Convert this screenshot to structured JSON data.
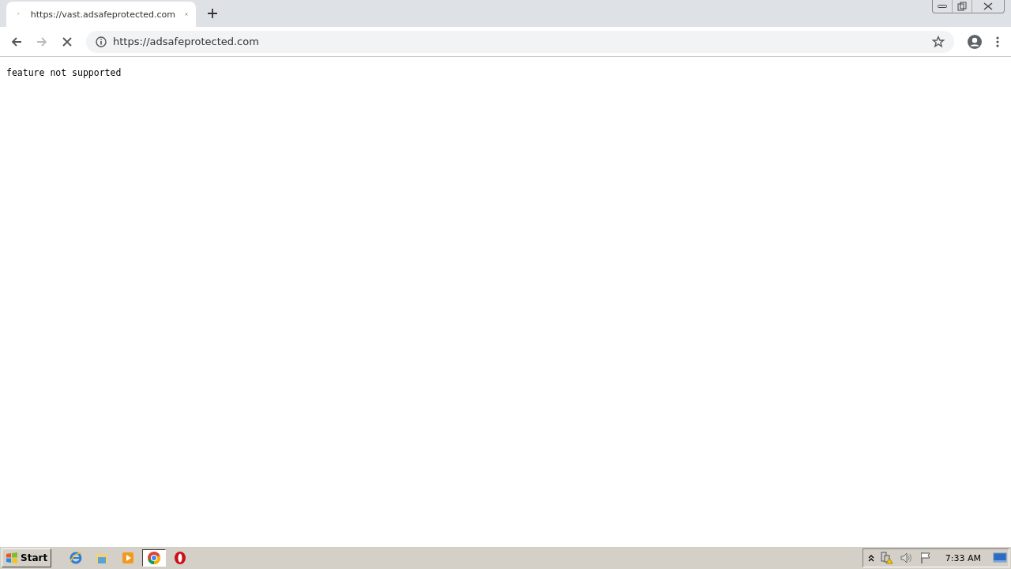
{
  "browser": {
    "tabs": [
      {
        "title": "https://vast.adsafeprotected.com",
        "selected": true,
        "loading": true
      }
    ],
    "address": "https://adsafeprotected.com",
    "loading": true,
    "back_disabled": false,
    "forward_disabled": true
  },
  "page": {
    "text": "feature not supported"
  },
  "taskbar": {
    "start": "Start",
    "apps": [
      {
        "kind": "ie",
        "selected": false
      },
      {
        "kind": "explorer",
        "selected": false
      },
      {
        "kind": "media",
        "selected": false
      },
      {
        "kind": "chrome",
        "selected": true
      },
      {
        "kind": "opera",
        "selected": false
      }
    ],
    "clock": "7:33 AM"
  }
}
